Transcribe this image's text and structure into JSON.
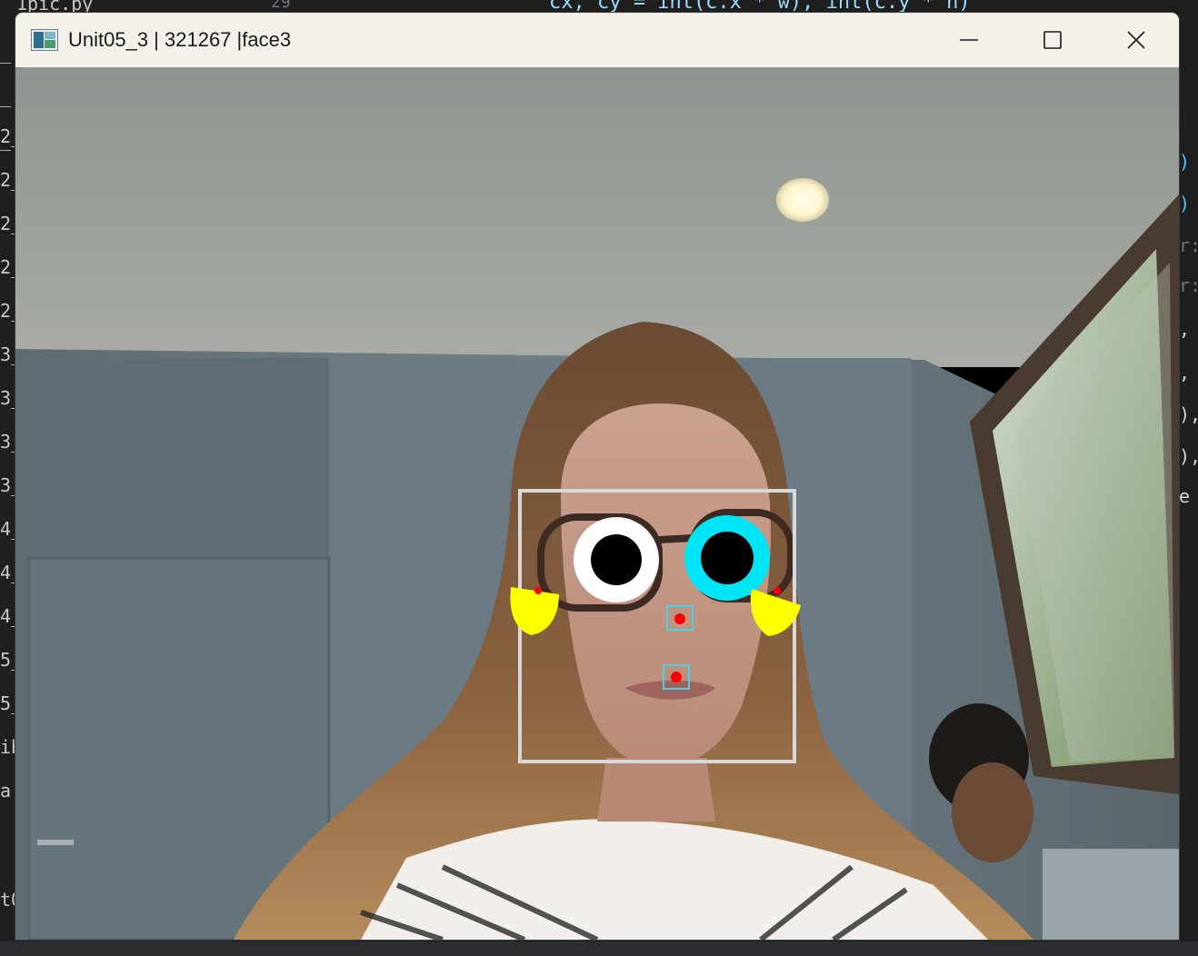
{
  "background_editor": {
    "tab_filename": "1pic.py",
    "line_number": "29",
    "code_line": "cx, cy = int(c.x * w), int(c.y * h)",
    "left_gutter": [
      "_",
      "_",
      "_",
      "2_",
      "2_",
      "2_",
      "2_",
      "2_",
      "3_",
      "3_",
      "3_",
      "3_",
      "4_",
      "4_",
      "4_",
      "5_",
      "5_",
      "ib",
      "a",
      "t0"
    ],
    "right_fragments": [
      ")",
      ")",
      "r:",
      "r:",
      ",",
      ",",
      "),",
      "),",
      "e"
    ]
  },
  "window": {
    "title": "Unit05_3 | 321267 |face3",
    "controls": {
      "minimize": "minimize",
      "maximize": "maximize",
      "close": "close"
    }
  },
  "camera_overlay": {
    "face_box_color": "#d8d8d8",
    "left_eye": {
      "ring_color": "#ffffff",
      "pupil_color": "#000000"
    },
    "right_eye": {
      "ring_color": "#00e5f5",
      "pupil_color": "#000000"
    },
    "ear_fill_color": "#ffff00",
    "landmark_dot_color": "#ff0000",
    "landmark_box_color": "#4dd0e1"
  }
}
